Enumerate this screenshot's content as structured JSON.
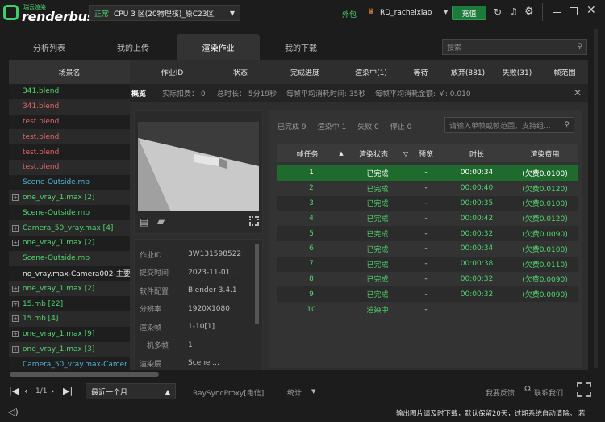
{
  "app": {
    "logo_small": "瑞云渲染",
    "logo_text": "renderbus"
  },
  "titlebar": {
    "cpu_status": "正常",
    "cpu_label": "CPU 3 区(20物理核)_原C23区",
    "plugin_label": "外包",
    "username": "RD_rachelxiao",
    "charge_label": "充值"
  },
  "tabs": [
    "分析列表",
    "我的上传",
    "渲染作业",
    "我的下载"
  ],
  "search": {
    "placeholder": "搜索"
  },
  "left": {
    "header": "场景名",
    "scenes": [
      {
        "name": "341.blend",
        "color": "#4fd56e",
        "expand": false
      },
      {
        "name": "341.blend",
        "color": "#e06666",
        "expand": false
      },
      {
        "name": "test.blend",
        "color": "#e06666",
        "expand": false
      },
      {
        "name": "test.blend",
        "color": "#e06666",
        "expand": false
      },
      {
        "name": "test.blend",
        "color": "#e06666",
        "expand": false
      },
      {
        "name": "test.blend",
        "color": "#e06666",
        "expand": false
      },
      {
        "name": "Scene-Outside.mb",
        "color": "#4db6d6",
        "expand": false
      },
      {
        "name": "one_vray_1.max [2]",
        "color": "#4fd56e",
        "expand": true
      },
      {
        "name": "Scene-Outside.mb",
        "color": "#4fd56e",
        "expand": false
      },
      {
        "name": "Camera_50_vray.max [4]",
        "color": "#4fd56e",
        "expand": true
      },
      {
        "name": "one_vray_1.max [2]",
        "color": "#4fd56e",
        "expand": true
      },
      {
        "name": "Scene-Outside.mb",
        "color": "#4fd56e",
        "expand": false
      },
      {
        "name": "no_vray.max-Camera002-主要",
        "color": "#e8e8e8",
        "expand": false
      },
      {
        "name": "one_vray_1.max [2]",
        "color": "#4fd56e",
        "expand": true
      },
      {
        "name": "15.mb [22]",
        "color": "#4fd56e",
        "expand": true
      },
      {
        "name": "15.mb [4]",
        "color": "#4fd56e",
        "expand": true
      },
      {
        "name": "one_vray_1.max [9]",
        "color": "#4fd56e",
        "expand": true
      },
      {
        "name": "one_vray_1.max [3]",
        "color": "#4fd56e",
        "expand": true
      },
      {
        "name": "Camera_50_vray.max-Camer",
        "color": "#4db6d6",
        "expand": false
      }
    ]
  },
  "main_header": [
    "作业ID",
    "状态",
    "完成进度",
    "渲染中(1)",
    "等待",
    "放弃(881)",
    "失败(31)",
    "帧范围"
  ],
  "summary": {
    "title": "概览",
    "deduct": "实际扣费： 0",
    "total_time": "总时长： 5分19秒",
    "avg_time": "每帧平均消耗时间: 35秒",
    "avg_cost": "每帧平均消耗金额: ￥: 0.010"
  },
  "info": [
    {
      "k": "作业ID",
      "v": "3W131598522"
    },
    {
      "k": "提交时间",
      "v": "2023-11-01 ..."
    },
    {
      "k": "软件配置",
      "v": "Blender 3.4.1"
    },
    {
      "k": "分辨率",
      "v": "1920X1080"
    },
    {
      "k": "渲染帧",
      "v": "1-10[1]"
    },
    {
      "k": "一机多帧",
      "v": "1"
    },
    {
      "k": "渲染层",
      "v": "Scene ..."
    }
  ],
  "frames": {
    "stats": {
      "done": "已完成 9",
      "rendering": "渲染中 1",
      "failed": "失败 0",
      "stopped": "停止 0"
    },
    "search_placeholder": "请输入单帧或帧范围，支持组...",
    "headers": [
      "帧任务",
      "渲染状态",
      "预览",
      "时长",
      "渲染费用"
    ],
    "rows": [
      {
        "frame": "1",
        "status": "已完成",
        "preview": "-",
        "time": "00:00:34",
        "cost": "(欠费0.0100)",
        "selected": true
      },
      {
        "frame": "2",
        "status": "已完成",
        "preview": "-",
        "time": "00:00:40",
        "cost": "(欠费0.0120)",
        "selected": false
      },
      {
        "frame": "3",
        "status": "已完成",
        "preview": "-",
        "time": "00:00:35",
        "cost": "(欠费0.0100)",
        "selected": false
      },
      {
        "frame": "4",
        "status": "已完成",
        "preview": "-",
        "time": "00:00:42",
        "cost": "(欠费0.0120)",
        "selected": false
      },
      {
        "frame": "5",
        "status": "已完成",
        "preview": "-",
        "time": "00:00:32",
        "cost": "(欠费0.0090)",
        "selected": false
      },
      {
        "frame": "6",
        "status": "已完成",
        "preview": "-",
        "time": "00:00:34",
        "cost": "(欠费0.0100)",
        "selected": false
      },
      {
        "frame": "7",
        "status": "已完成",
        "preview": "-",
        "time": "00:00:38",
        "cost": "(欠费0.0110)",
        "selected": false
      },
      {
        "frame": "8",
        "status": "已完成",
        "preview": "-",
        "time": "00:00:32",
        "cost": "(欠费0.0090)",
        "selected": false
      },
      {
        "frame": "9",
        "status": "已完成",
        "preview": "-",
        "time": "00:00:32",
        "cost": "(欠费0.0090)",
        "selected": false
      },
      {
        "frame": "10",
        "status": "渲染中",
        "preview": "-",
        "time": "",
        "cost": "",
        "selected": false
      }
    ]
  },
  "bottom": {
    "page": "1/1",
    "period": "最近一个月",
    "proxy": "RaySyncProxy[电信]",
    "stats": "统计",
    "feedback": "我要反馈",
    "contact": "联系我们"
  },
  "status": {
    "message": "输出图片请及时下载，默认保留20天，过期系统自动清除。 若"
  }
}
